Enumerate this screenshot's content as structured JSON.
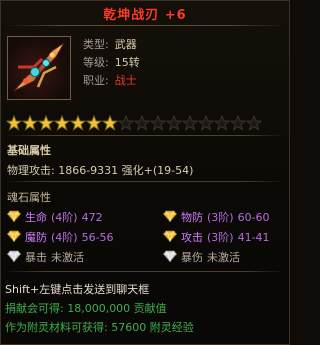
{
  "item": {
    "name": "乾坤战刃 +6",
    "type_label": "类型:",
    "type_value": "武器",
    "level_label": "等级:",
    "level_value": "15转",
    "class_label": "职业:",
    "class_value": "战士"
  },
  "stars": {
    "filled": 7,
    "total": 16
  },
  "basic": {
    "title": "基础属性",
    "attack_line": "物理攻击: 1866-9331 强化+(19-54)"
  },
  "soulstone": {
    "title": "魂石属性",
    "rows": [
      [
        {
          "stat": "生命",
          "tier": "(4阶)",
          "value": "472",
          "active": true,
          "gem": "gold"
        },
        {
          "stat": "物防",
          "tier": "(3阶)",
          "value": "60-60",
          "active": true,
          "gem": "gold"
        }
      ],
      [
        {
          "stat": "魔防",
          "tier": "(4阶)",
          "value": "56-56",
          "active": true,
          "gem": "gold"
        },
        {
          "stat": "攻击",
          "tier": "(3阶)",
          "value": "41-41",
          "active": true,
          "gem": "gold"
        }
      ],
      [
        {
          "stat": "暴击",
          "tier": "",
          "value": "未激活",
          "active": false,
          "gem": "white"
        },
        {
          "stat": "暴伤",
          "tier": "",
          "value": "未激活",
          "active": false,
          "gem": "white"
        }
      ]
    ]
  },
  "footer": {
    "hint": "Shift+左键点击发送到聊天框",
    "donation": "捐献会可得: 18,000,000 贡献值",
    "material": "作为附灵材料可获得: 57600 附灵经验"
  },
  "colors": {
    "title_red": "#ff3b22",
    "class_red": "#e43a2a",
    "gem_purple": "#d07bff",
    "footer_green": "#3fae4a",
    "star_gold": "#f0c53a"
  }
}
